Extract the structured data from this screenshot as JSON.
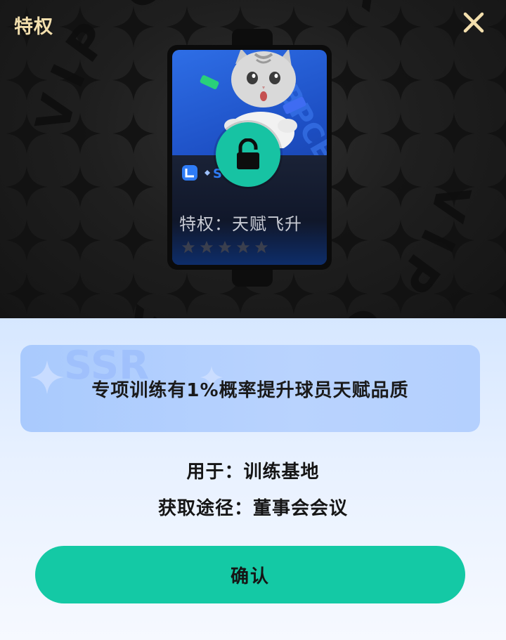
{
  "header": {
    "title": "特权",
    "close_icon": "close-icon"
  },
  "background": {
    "ring_text": "VIP CENTER"
  },
  "card": {
    "name": "特权：天赋飞升",
    "stars": 5,
    "badge_icon": "ssr-logo-icon",
    "lock_icon": "unlock-icon",
    "character_icon": "cat-icon",
    "accent_color": "#17c3a3"
  },
  "detail": {
    "description": "专项训练有1%概率提升球员天赋品质",
    "watermark": "SSR",
    "use_label": "用于：",
    "use_value": "训练基地",
    "source_label": "获取途径：",
    "source_value": "董事会会议"
  },
  "actions": {
    "confirm_label": "确认",
    "confirm_color": "#14c9a5"
  }
}
